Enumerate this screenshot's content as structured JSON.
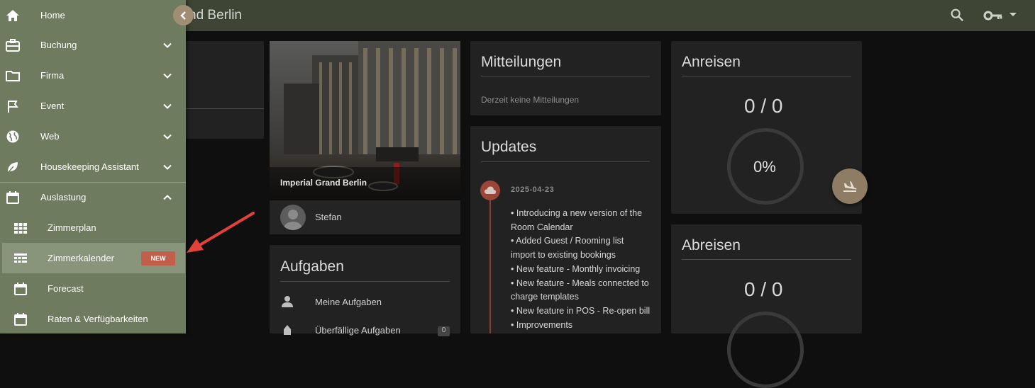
{
  "header": {
    "title": "nd Berlin"
  },
  "sidebar": {
    "items": [
      {
        "label": "Home"
      },
      {
        "label": "Buchung"
      },
      {
        "label": "Firma"
      },
      {
        "label": "Event"
      },
      {
        "label": "Web"
      },
      {
        "label": "Housekeeping Assistant"
      },
      {
        "label": "Auslastung"
      }
    ],
    "subitems": [
      {
        "label": "Zimmerplan"
      },
      {
        "label": "Zimmerkalender",
        "badge": "NEW"
      },
      {
        "label": "Forecast"
      },
      {
        "label": "Raten & Verfügbarkeiten"
      }
    ]
  },
  "hotel": {
    "name": "Imperial Grand Berlin",
    "user": "Stefan"
  },
  "tasks": {
    "title": "Aufgaben",
    "items": [
      {
        "label": "Meine Aufgaben"
      },
      {
        "label": "Überfällige Aufgaben",
        "count": "0"
      }
    ]
  },
  "messages": {
    "title": "Mitteilungen",
    "empty": "Derzeit keine Mitteilungen"
  },
  "updates": {
    "title": "Updates",
    "date": "2025-04-23",
    "lines": [
      "• Introducing a new version of the",
      "Room Calendar",
      "• Added Guest / Rooming list",
      "import to existing bookings",
      "• New feature - Monthly invoicing",
      "• New feature - Meals connected to",
      "charge templates",
      "• New feature in POS - Re-open bill",
      "• Improvements"
    ]
  },
  "arrivals": {
    "title": "Anreisen",
    "count": "0 / 0",
    "percent": "0%"
  },
  "departures": {
    "title": "Abreisen",
    "count": "0 / 0"
  },
  "colors": {
    "sidebar": "#6e7b5e",
    "topbar": "#3e4535",
    "badge": "#c25f4a",
    "accent": "#8e7c64"
  }
}
